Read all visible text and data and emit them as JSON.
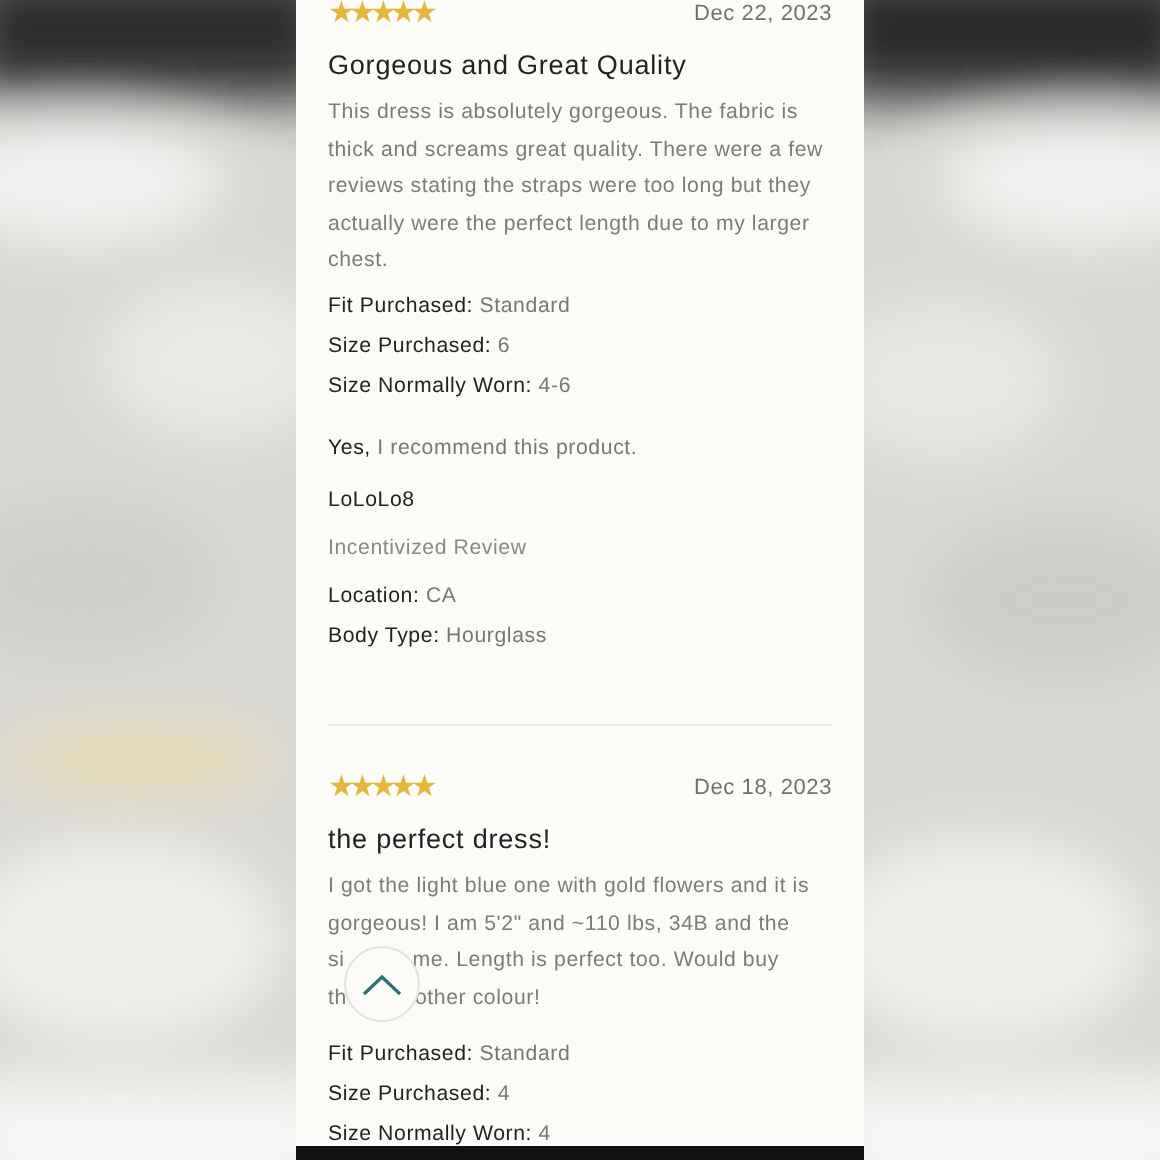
{
  "reviews": [
    {
      "stars": 5,
      "date": "Dec 22, 2023",
      "title": "Gorgeous and Great Quality",
      "body": "This dress is absolutely gorgeous. The fabric is thick and screams great quality. There were a few reviews stating the straps were too long but they actually were the perfect length due to my larger chest.",
      "details": [
        {
          "label": "Fit Purchased:",
          "value": "Standard"
        },
        {
          "label": "Size Purchased:",
          "value": "6"
        },
        {
          "label": "Size Normally Worn:",
          "value": "4-6"
        }
      ],
      "recommend": {
        "answer": "Yes,",
        "text": "I recommend this product."
      },
      "author": "LoLoLo8",
      "badge": "Incentivized Review",
      "profile": [
        {
          "label": "Location:",
          "value": "CA"
        },
        {
          "label": "Body Type:",
          "value": "Hourglass"
        }
      ]
    },
    {
      "stars": 5,
      "date": "Dec 18, 2023",
      "title": "the perfect dress!",
      "body_lines": [
        [
          "I got the light blue one with gold flowers and it is"
        ],
        [
          "gorgeous! I am 5'2\" and ~110 lbs, 34B and the"
        ],
        [
          "si",
          "me. Length is perfect too. Would buy"
        ],
        [
          "th",
          "other colour!"
        ]
      ],
      "details": [
        {
          "label": "Fit Purchased:",
          "value": "Standard"
        },
        {
          "label": "Size Purchased:",
          "value": "4"
        },
        {
          "label": "Size Normally Worn:",
          "value": "4"
        }
      ]
    }
  ],
  "scroll_top_button": {
    "kind": "chevron"
  }
}
